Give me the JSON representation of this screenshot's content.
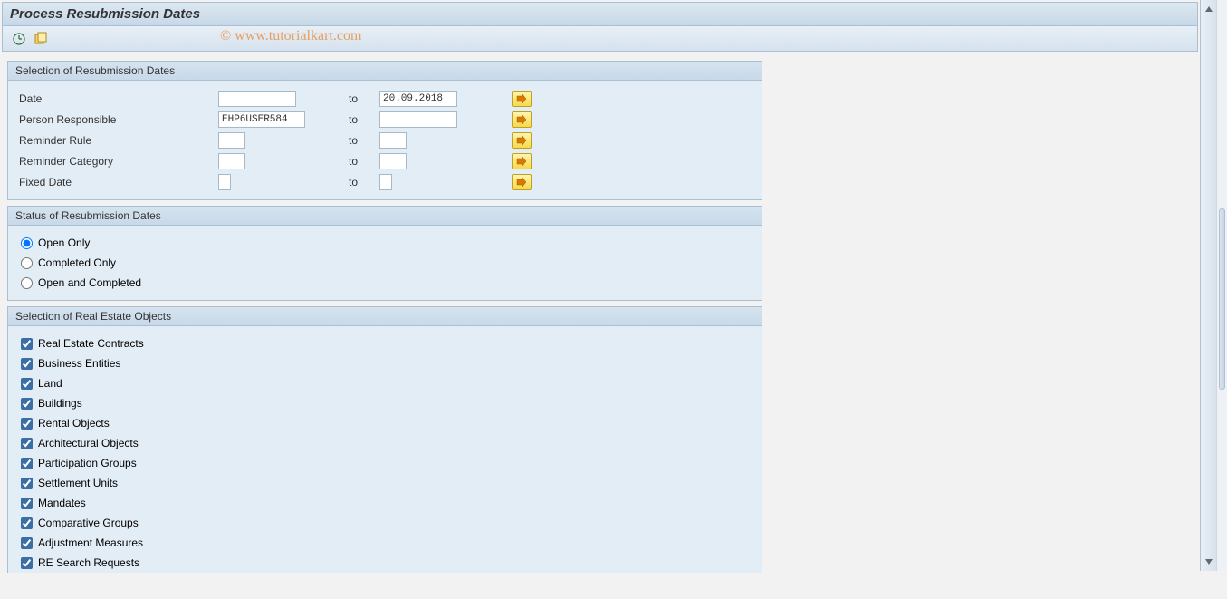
{
  "title": "Process Resubmission Dates",
  "watermark": "© www.tutorialkart.com",
  "group1": {
    "title": "Selection of Resubmission Dates",
    "rows": [
      {
        "label": "Date",
        "from": "",
        "to_label": "to",
        "to": "20.09.2018",
        "from_cls": "inp-date",
        "to_cls": "inp-date"
      },
      {
        "label": "Person Responsible",
        "from": "EHP6USER584",
        "to_label": "to",
        "to": "",
        "from_cls": "inp-user",
        "to_cls": "inp-date"
      },
      {
        "label": "Reminder Rule",
        "from": "",
        "to_label": "to",
        "to": "",
        "from_cls": "inp-short",
        "to_cls": "inp-short"
      },
      {
        "label": "Reminder Category",
        "from": "",
        "to_label": "to",
        "to": "",
        "from_cls": "inp-short",
        "to_cls": "inp-short"
      },
      {
        "label": "Fixed Date",
        "from": "",
        "to_label": "to",
        "to": "",
        "from_cls": "inp-tiny",
        "to_cls": "inp-tiny"
      }
    ]
  },
  "group2": {
    "title": "Status of Resubmission Dates",
    "options": [
      {
        "label": "Open Only",
        "checked": true
      },
      {
        "label": "Completed Only",
        "checked": false
      },
      {
        "label": "Open and Completed",
        "checked": false
      }
    ]
  },
  "group3": {
    "title": "Selection of Real Estate Objects",
    "options": [
      {
        "label": "Real Estate Contracts",
        "checked": true
      },
      {
        "label": "Business Entities",
        "checked": true
      },
      {
        "label": "Land",
        "checked": true
      },
      {
        "label": "Buildings",
        "checked": true
      },
      {
        "label": "Rental Objects",
        "checked": true
      },
      {
        "label": "Architectural Objects",
        "checked": true
      },
      {
        "label": "Participation Groups",
        "checked": true
      },
      {
        "label": "Settlement Units",
        "checked": true
      },
      {
        "label": "Mandates",
        "checked": true
      },
      {
        "label": "Comparative Groups",
        "checked": true
      },
      {
        "label": "Adjustment Measures",
        "checked": true
      },
      {
        "label": "RE Search Requests",
        "checked": true
      }
    ]
  }
}
